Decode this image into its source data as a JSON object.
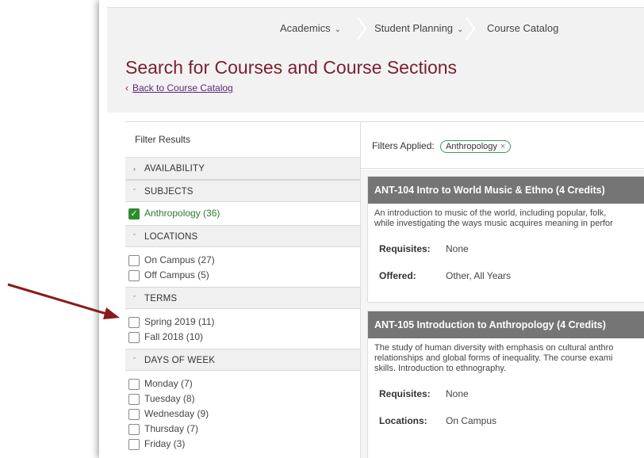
{
  "breadcrumb": {
    "items": [
      {
        "label": "Academics",
        "chevron": "chevron-down-icon"
      },
      {
        "label": "Student Planning",
        "chevron": "chevron-down-icon"
      },
      {
        "label": "Course Catalog"
      }
    ]
  },
  "page": {
    "title": "Search for Courses and Course Sections",
    "back_link": "Back to Course Catalog"
  },
  "filters": {
    "header": "Filter Results",
    "sections": [
      {
        "title": "AVAILABILITY",
        "expanded": false,
        "options": []
      },
      {
        "title": "SUBJECTS",
        "expanded": true,
        "options": [
          {
            "label": "Anthropology (36)",
            "checked": true
          }
        ]
      },
      {
        "title": "LOCATIONS",
        "expanded": true,
        "options": [
          {
            "label": "On Campus (27)",
            "checked": false
          },
          {
            "label": "Off Campus (5)",
            "checked": false
          }
        ]
      },
      {
        "title": "TERMS",
        "expanded": true,
        "options": [
          {
            "label": "Spring 2019 (11)",
            "checked": false
          },
          {
            "label": "Fall 2018 (10)",
            "checked": false
          }
        ]
      },
      {
        "title": "DAYS OF WEEK",
        "expanded": true,
        "options": [
          {
            "label": "Monday (7)",
            "checked": false
          },
          {
            "label": "Tuesday (8)",
            "checked": false
          },
          {
            "label": "Wednesday (9)",
            "checked": false
          },
          {
            "label": "Thursday (7)",
            "checked": false
          },
          {
            "label": "Friday (3)",
            "checked": false
          }
        ]
      }
    ]
  },
  "applied": {
    "label": "Filters Applied:",
    "chips": [
      "Anthropology"
    ]
  },
  "courses": [
    {
      "title": "ANT-104 Intro to World Music & Ethno (4 Credits)",
      "description": [
        "An introduction to music of the world, including popular, folk,",
        "while investigating the ways music acquires meaning in perfor"
      ],
      "fields": [
        {
          "key": "Requisites:",
          "value": "None"
        },
        {
          "key": "Offered:",
          "value": "Other, All Years"
        }
      ]
    },
    {
      "title": "ANT-105 Introduction to Anthropology (4 Credits)",
      "description": [
        "The study of human diversity with emphasis on cultural anthro",
        "relationships and global forms of inequality. The course exami",
        "skills. Introduction to ethnography."
      ],
      "fields": [
        {
          "key": "Requisites:",
          "value": "None"
        },
        {
          "key": "Locations:",
          "value": "On Campus"
        }
      ]
    }
  ],
  "colors": {
    "title": "#7a1f2b",
    "check": "#2e8b2e",
    "card_header": "#757575",
    "arrow": "#8b1a1a"
  }
}
